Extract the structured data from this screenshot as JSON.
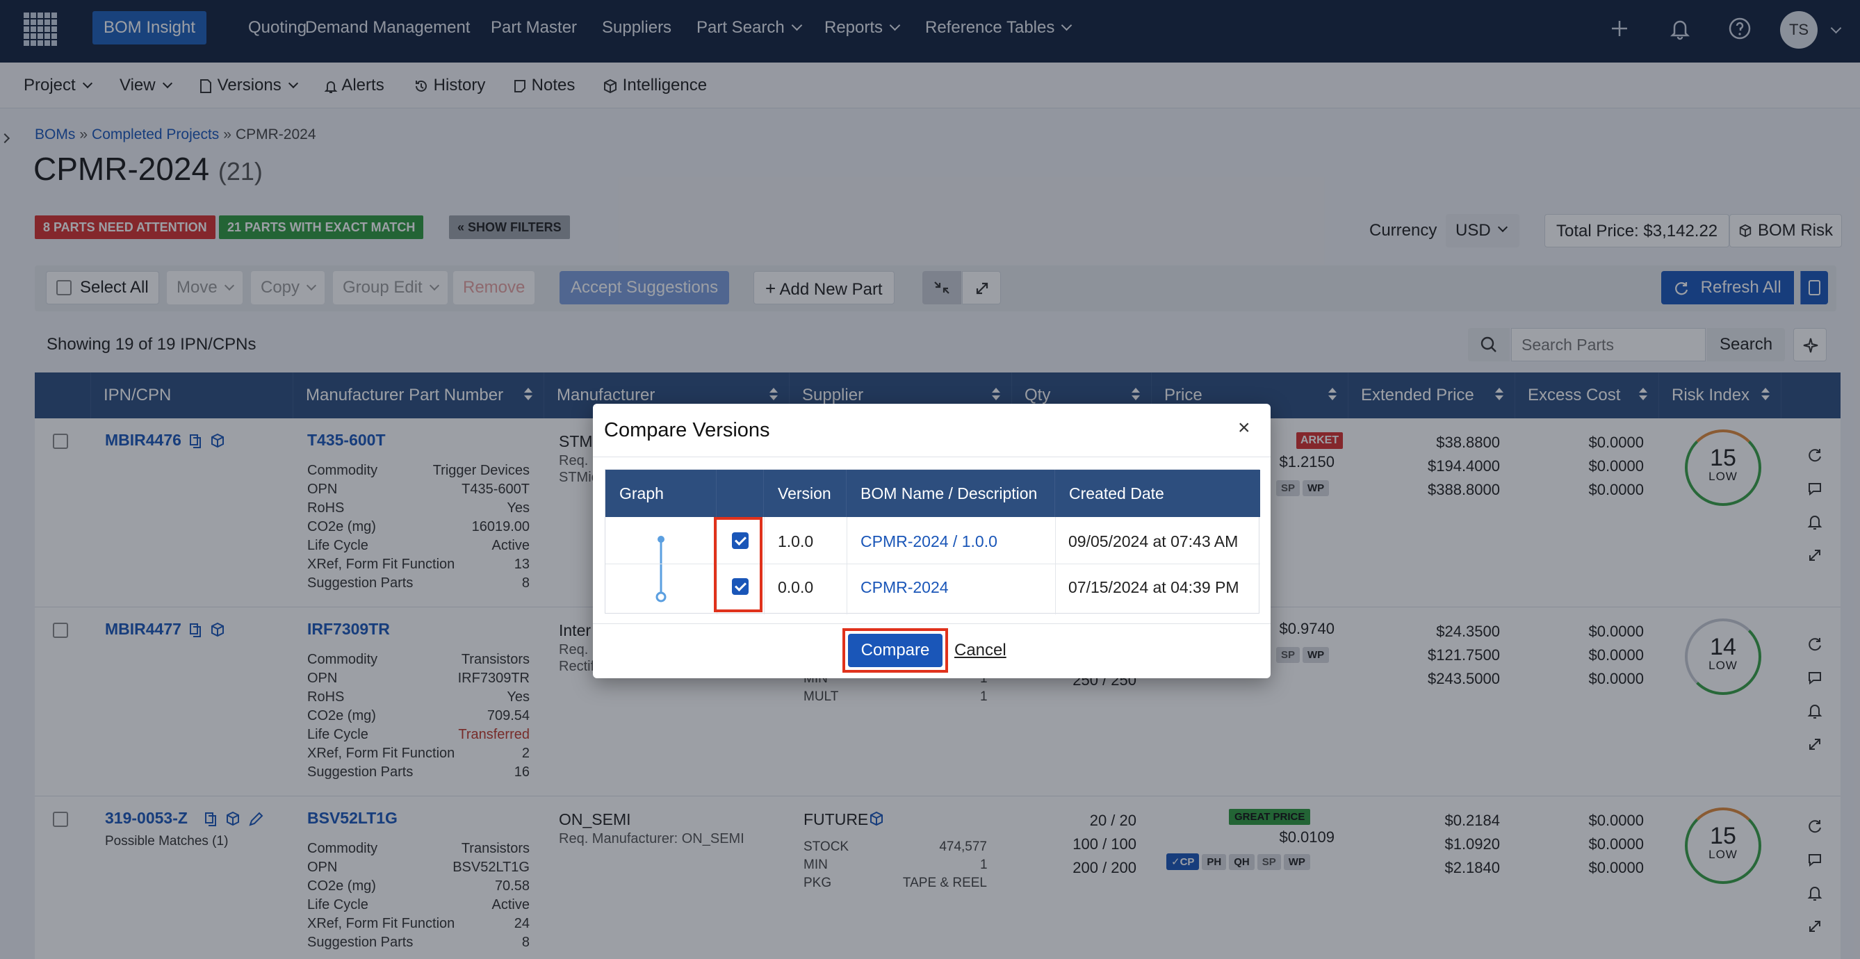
{
  "topnav": {
    "items": [
      "BOM Insight",
      "Quoting",
      "Demand Management",
      "Part Master",
      "Suppliers",
      "Part Search",
      "Reports",
      "Reference Tables"
    ],
    "avatar": "TS"
  },
  "subnav": {
    "items": [
      "Project",
      "View",
      "Versions",
      "Alerts",
      "History",
      "Notes",
      "Intelligence"
    ]
  },
  "breadcrumb": {
    "bom": "BOMs",
    "sep": "»",
    "completed": "Completed Projects",
    "current": "CPMR-2024"
  },
  "page": {
    "title": "CPMR-2024",
    "count": "(21)"
  },
  "tags": {
    "attention": "8 PARTS NEED ATTENTION",
    "exact": "21 PARTS WITH EXACT MATCH",
    "filters": "« SHOW FILTERS"
  },
  "currency": {
    "label": "Currency",
    "value": "USD"
  },
  "total_price": "Total Price: $3,142.22",
  "bom_risk": "BOM Risk",
  "toolbar": {
    "select_all": "Select All",
    "move": "Move",
    "copy": "Copy",
    "group_edit": "Group Edit",
    "remove": "Remove",
    "accept": "Accept Suggestions",
    "add_new": "Add New Part",
    "refresh_all": "Refresh All"
  },
  "showing": "Showing 19 of 19 IPN/CPNs",
  "search": {
    "placeholder": "Search Parts",
    "button": "Search"
  },
  "table": {
    "headers": [
      "IPN/CPN",
      "Manufacturer Part Number",
      "Manufacturer",
      "Supplier",
      "Qty",
      "Price",
      "Extended Price",
      "Excess Cost",
      "Risk Index"
    ],
    "field_labels": {
      "commodity": "Commodity",
      "opn": "OPN",
      "rohs": "RoHS",
      "co2": "CO2e (mg)",
      "life": "Life Cycle",
      "xref": "XRef, Form Fit Function",
      "sugg": "Suggestion Parts",
      "stock": "STOCK",
      "min": "MIN",
      "mult": "MULT",
      "pkg": "PKG"
    },
    "rows": [
      {
        "ipn": "MBIR4476",
        "mpn": "T435-600T",
        "commodity": "Trigger Devices",
        "opn": "T435-600T",
        "rohs": "Yes",
        "co2": "16019.00",
        "life": "Active",
        "xref": "13",
        "sugg": "8",
        "mfr": "STM",
        "mfr_req": "Req. M",
        "mfr_extra": "STMic",
        "price": "$1.2150",
        "price_tag": "ARKET",
        "ext": [
          "$38.8800",
          "$194.4000",
          "$388.8000"
        ],
        "excess": [
          "$0.0000",
          "$0.0000",
          "$0.0000"
        ],
        "risk": "15",
        "risk_level": "LOW"
      },
      {
        "ipn": "MBIR4477",
        "mpn": "IRF7309TR",
        "commodity": "Transistors",
        "opn": "IRF7309TR",
        "rohs": "Yes",
        "co2": "709.54",
        "life": "Transferred",
        "xref": "2",
        "sugg": "16",
        "mfr": "Inter",
        "mfr_req": "Req. M",
        "mfr_extra": "Rectif",
        "sup_min": "1",
        "sup_mult": "1",
        "qty": "250 / 250",
        "price": "$0.9740",
        "ext": [
          "$24.3500",
          "$121.7500",
          "$243.5000"
        ],
        "excess": [
          "$0.0000",
          "$0.0000",
          "$0.0000"
        ],
        "risk": "14",
        "risk_level": "LOW"
      },
      {
        "ipn": "319-0053-Z",
        "possible": "Possible Matches (1)",
        "mpn": "BSV52LT1G",
        "commodity": "Transistors",
        "opn": "BSV52LT1G",
        "co2": "70.58",
        "life": "Active",
        "xref": "24",
        "sugg": "8",
        "mfr": "ON_SEMI",
        "mfr_req": "Req. Manufacturer: ON_SEMI",
        "supplier": "FUTURE",
        "stock": "474,577",
        "sup_min": "1",
        "pkg": "TAPE & REEL",
        "qty": [
          "20 / 20",
          "100 / 100",
          "200 / 200"
        ],
        "price_tag": "GREAT PRICE",
        "price": "$0.0109",
        "ext": [
          "$0.2184",
          "$1.0920",
          "$2.1840"
        ],
        "excess": [
          "$0.0000",
          "$0.0000",
          "$0.0000"
        ],
        "risk": "15",
        "risk_level": "LOW"
      }
    ],
    "pills": [
      "SP",
      "WP",
      "✓CP",
      "PH",
      "QH"
    ]
  },
  "modal": {
    "title": "Compare Versions",
    "headers": [
      "Graph",
      "",
      "Version",
      "BOM Name / Description",
      "Created Date"
    ],
    "rows": [
      {
        "version": "1.0.0",
        "name": "CPMR-2024 / 1.0.0",
        "date": "09/05/2024 at 07:43 AM"
      },
      {
        "version": "0.0.0",
        "name": "CPMR-2024",
        "date": "07/15/2024 at 04:39 PM"
      }
    ],
    "compare": "Compare",
    "cancel": "Cancel"
  },
  "colors": {
    "nav": "#14233f",
    "header": "#2d4e7e",
    "primary": "#1a56b8",
    "danger": "#d6312f",
    "success": "#2f9a3f",
    "highlight": "#e0321c"
  }
}
